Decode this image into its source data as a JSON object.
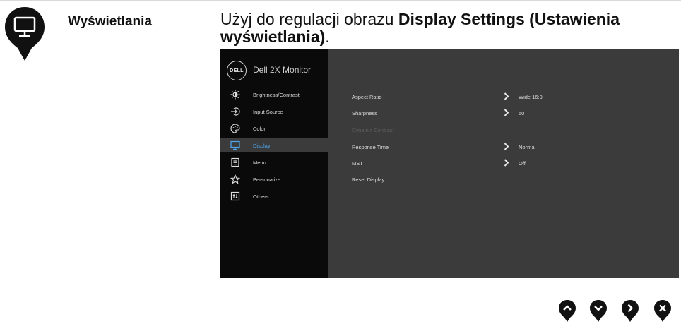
{
  "section": {
    "label": "Wyświetlania",
    "icon": "monitor-icon"
  },
  "intro": {
    "prefix": "Użyj do regulacji obrazu ",
    "bold": "Display Settings (Ustawienia wyświetlania)",
    "suffix": "."
  },
  "osd": {
    "logo": "DELL",
    "title": "Dell 2X Monitor",
    "menu": [
      {
        "label": "Brightness/Contrast",
        "icon": "brightness-icon",
        "active": false
      },
      {
        "label": "Input Source",
        "icon": "input-source-icon",
        "active": false
      },
      {
        "label": "Color",
        "icon": "color-palette-icon",
        "active": false
      },
      {
        "label": "Display",
        "icon": "display-icon",
        "active": true
      },
      {
        "label": "Menu",
        "icon": "menu-icon",
        "active": false
      },
      {
        "label": "Personalize",
        "icon": "star-icon",
        "active": false
      },
      {
        "label": "Others",
        "icon": "others-icon",
        "active": false
      }
    ],
    "settings": [
      {
        "label": "Aspect Ratio",
        "value": "Wide 16:9",
        "arrow": true,
        "disabled": false
      },
      {
        "label": "Sharpness",
        "value": "50",
        "arrow": true,
        "disabled": false
      },
      {
        "label": "Dynamic Contrast",
        "value": "",
        "arrow": false,
        "disabled": true
      },
      {
        "label": "Response Time",
        "value": "Normal",
        "arrow": true,
        "disabled": false
      },
      {
        "label": "MST",
        "value": "Off",
        "arrow": true,
        "disabled": false
      },
      {
        "label": "Reset Display",
        "value": "",
        "arrow": false,
        "disabled": false
      }
    ]
  },
  "nav_buttons": [
    {
      "icon": "chevron-up-icon"
    },
    {
      "icon": "chevron-down-icon"
    },
    {
      "icon": "chevron-right-icon"
    },
    {
      "icon": "close-icon"
    }
  ]
}
